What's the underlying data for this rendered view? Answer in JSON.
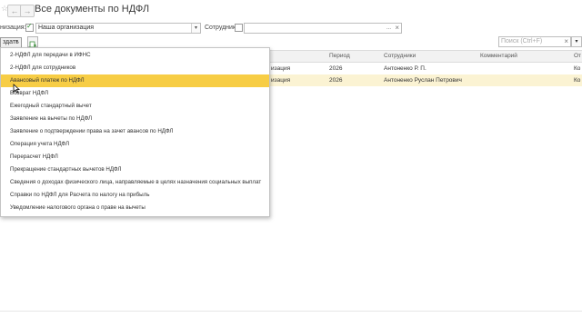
{
  "window": {
    "title": "Все документы по НДФЛ",
    "nav_back": "←",
    "nav_forward": "→"
  },
  "filters": {
    "organization_label": "низация:",
    "organization_value": "Наша организация",
    "employee_label": "Сотрудник:",
    "employee_value": "",
    "employee_select_glyph": "...",
    "clear_glyph": "×"
  },
  "toolbar": {
    "create_label": "здать",
    "search_placeholder": "Поиск (Ctrl+F)",
    "search_clear_glyph": "×"
  },
  "table": {
    "columns": [
      "Период",
      "Сотрудники",
      "Комментарий",
      "От"
    ],
    "rows": [
      {
        "left_tail": "изация",
        "period": "2026",
        "employees": "Антоненко Р. П.",
        "comment": "",
        "right_tail": "Ко"
      },
      {
        "left_tail": "изация",
        "period": "2026",
        "employees": "Антоненко Руслан Петрович",
        "comment": "",
        "right_tail": "Ко"
      }
    ]
  },
  "menu": {
    "items": [
      "2-НДФЛ для передачи в ИФНС",
      "2-НДФЛ для сотрудников",
      "Авансовый платеж по НДФЛ",
      "Возврат НДФЛ",
      "Ежегодный стандартный вычет",
      "Заявление на вычеты по НДФЛ",
      "Заявление о подтверждении права на зачет авансов по НДФЛ",
      "Операция учета НДФЛ",
      "Перерасчет НДФЛ",
      "Прекращение стандартных вычетов НДФЛ",
      "Сведения о доходах физического лица, направляемые в целях назначения социальных выплат",
      "Справки по НДФЛ для Расчета по налогу на прибыль",
      "Уведомление налогового органа о праве на вычеты"
    ],
    "highlighted_index": 2,
    "highlight_color": "#f7cd45"
  },
  "icons": {
    "star": "☆",
    "dropdown": "▾",
    "cursor": "pointer-cursor",
    "refresh": "document-add-icon"
  }
}
